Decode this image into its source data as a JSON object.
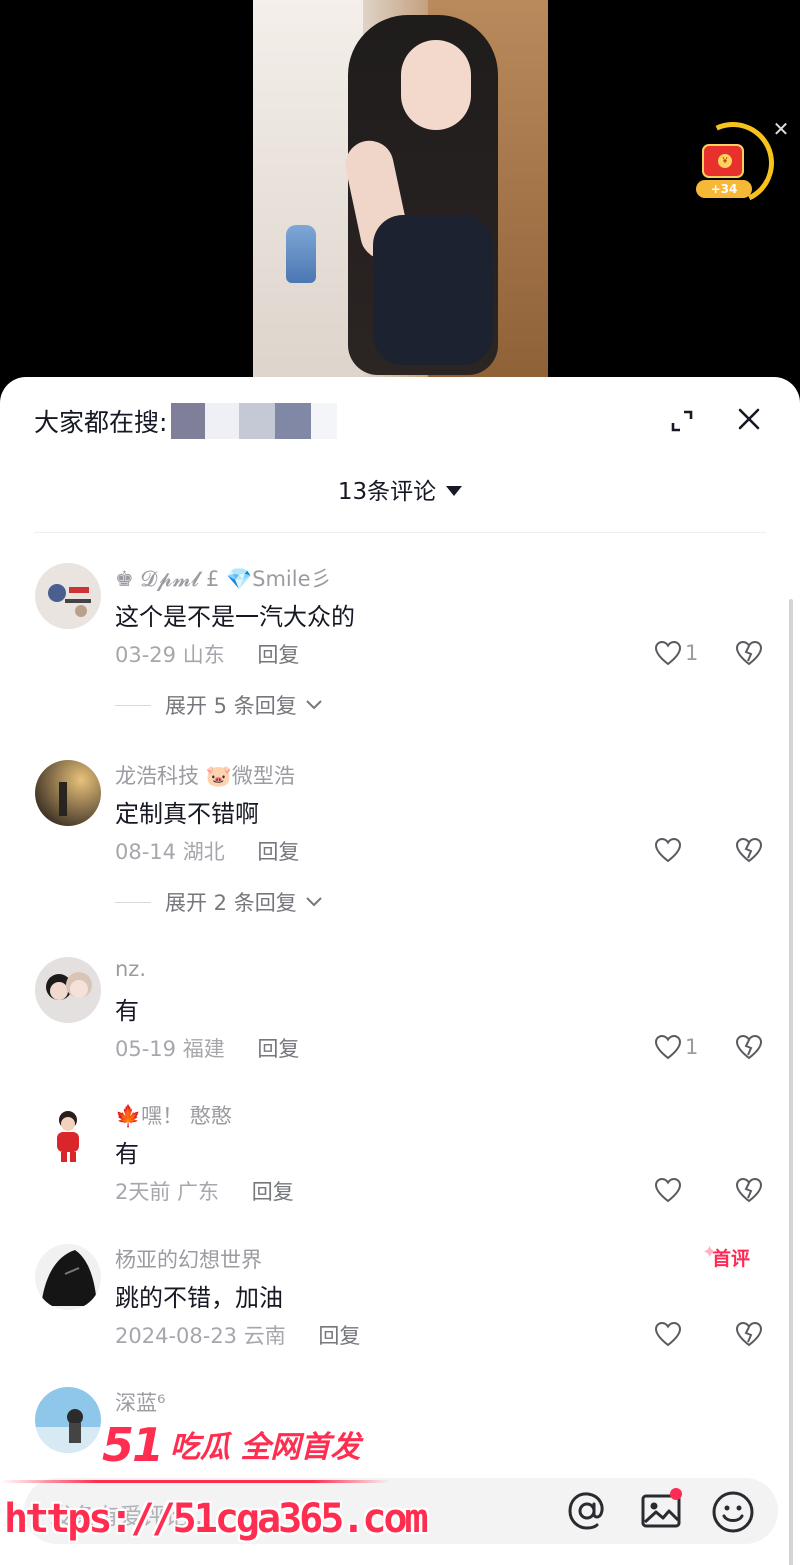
{
  "video": {
    "reward_amount": "+34",
    "reward_seal": "￥",
    "close_glyph": "✕"
  },
  "sheet": {
    "search_prefix": "大家都在搜:",
    "comment_count_label": "13条评论",
    "input_placeholder": "发条有爱评论..."
  },
  "comments": [
    {
      "author": "♚ 𝓓𝓹𝓶𝓵 £ 💎Smile彡",
      "text": "这个是不是一汽大众的",
      "date": "03-29",
      "location": "山东",
      "reply": "回复",
      "likes": "1",
      "expand": "展开 5 条回复"
    },
    {
      "author": "龙浩科技 🐷微型浩",
      "text": "定制真不错啊",
      "date": "08-14",
      "location": "湖北",
      "reply": "回复",
      "likes": "",
      "expand": "展开 2 条回复"
    },
    {
      "author": "nz.",
      "text": "有",
      "date": "05-19",
      "location": "福建",
      "reply": "回复",
      "likes": "1"
    },
    {
      "author": "🍁嘿！ 憨憨",
      "text": "有",
      "date": "2天前",
      "location": "广东",
      "reply": "回复",
      "likes": ""
    },
    {
      "author": "杨亚的幻想世界",
      "text": "跳的不错，加油",
      "date": "2024-08-23",
      "location": "云南",
      "reply": "回复",
      "likes": "",
      "badge": "首评"
    },
    {
      "author": "深蓝⁶",
      "text": "",
      "date": "",
      "location": "",
      "reply": "",
      "likes": ""
    }
  ],
  "watermark": {
    "number": "51",
    "tagline": "吃瓜 全网首发",
    "url": "https://51cga365.com"
  },
  "colors": {
    "accent": "#fe2c55",
    "watermark": "#ff2d4f",
    "text_primary": "#161823",
    "text_secondary": "#9b9ca2",
    "reward_ring": "#f6c21b"
  },
  "icons": [
    "expand-icon",
    "close-icon",
    "dropdown-caret-icon",
    "heart-icon",
    "broken-heart-icon",
    "chevron-down-icon",
    "at-icon",
    "image-icon",
    "emoji-icon",
    "red-envelope-icon"
  ]
}
